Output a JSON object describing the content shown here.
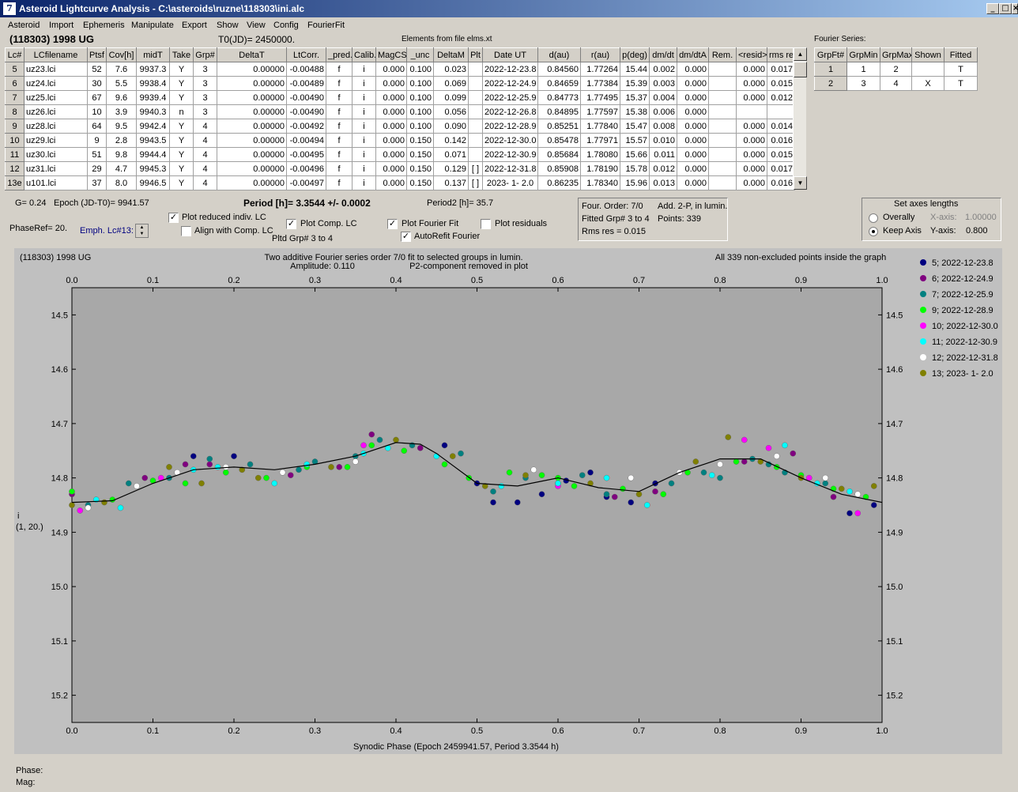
{
  "window": {
    "title": "Asteroid Lightcurve Analysis - C:\\asteroids\\ruzne\\118303\\ini.alc",
    "icon_glyph": "7"
  },
  "menu": [
    "Asteroid",
    "Import",
    "Ephemeris",
    "Manipulate",
    "Export",
    "Show",
    "View",
    "Config",
    "FourierFit"
  ],
  "header": {
    "object": "(118303) 1998 UG",
    "t0": "T0(JD)= 2450000.",
    "elements": "Elements from file elms.xt",
    "fourier_title": "Fourier Series:"
  },
  "lc_table": {
    "columns": [
      "Lc#",
      "LCfilename",
      "Ptsf",
      "Cov[h]",
      "midT",
      "Take",
      "Grp#",
      "DeltaT",
      "LtCorr.",
      "_pred.",
      "Calib.",
      "MagCS",
      "_unc",
      "DeltaM",
      "Plt",
      "Date UT",
      "d(au)",
      "r(au)",
      "p(deg)",
      "dm/dt",
      "dm/dtA",
      "Rem.",
      "<resid>",
      "rms res"
    ],
    "rows": [
      [
        "5",
        "uz23.lci",
        "52",
        "7.6",
        "9937.3",
        "Y",
        "3",
        "0.00000",
        "-0.00488",
        "f",
        "i",
        "0.000",
        "0.100",
        "0.023",
        "",
        "2022-12-23.8",
        "0.84560",
        "1.77264",
        "15.44",
        "0.002",
        "0.000",
        "",
        "0.000",
        "0.017"
      ],
      [
        "6",
        "uz24.lci",
        "30",
        "5.5",
        "9938.4",
        "Y",
        "3",
        "0.00000",
        "-0.00489",
        "f",
        "i",
        "0.000",
        "0.100",
        "0.069",
        "",
        "2022-12-24.9",
        "0.84659",
        "1.77384",
        "15.39",
        "0.003",
        "0.000",
        "",
        "0.000",
        "0.015"
      ],
      [
        "7",
        "uz25.lci",
        "67",
        "9.6",
        "9939.4",
        "Y",
        "3",
        "0.00000",
        "-0.00490",
        "f",
        "i",
        "0.000",
        "0.100",
        "0.099",
        "",
        "2022-12-25.9",
        "0.84773",
        "1.77495",
        "15.37",
        "0.004",
        "0.000",
        "",
        "0.000",
        "0.012"
      ],
      [
        "8",
        "uz26.lci",
        "10",
        "3.9",
        "9940.3",
        "n",
        "3",
        "0.00000",
        "-0.00490",
        "f",
        "i",
        "0.000",
        "0.100",
        "0.056",
        "",
        "2022-12-26.8",
        "0.84895",
        "1.77597",
        "15.38",
        "0.006",
        "0.000",
        "",
        "",
        ""
      ],
      [
        "9",
        "uz28.lci",
        "64",
        "9.5",
        "9942.4",
        "Y",
        "4",
        "0.00000",
        "-0.00492",
        "f",
        "i",
        "0.000",
        "0.100",
        "0.090",
        "",
        "2022-12-28.9",
        "0.85251",
        "1.77840",
        "15.47",
        "0.008",
        "0.000",
        "",
        "0.000",
        "0.014"
      ],
      [
        "10",
        "uz29.lci",
        "9",
        "2.8",
        "9943.5",
        "Y",
        "4",
        "0.00000",
        "-0.00494",
        "f",
        "i",
        "0.000",
        "0.150",
        "0.142",
        "",
        "2022-12-30.0",
        "0.85478",
        "1.77971",
        "15.57",
        "0.010",
        "0.000",
        "",
        "0.000",
        "0.016"
      ],
      [
        "11",
        "uz30.lci",
        "51",
        "9.8",
        "9944.4",
        "Y",
        "4",
        "0.00000",
        "-0.00495",
        "f",
        "i",
        "0.000",
        "0.150",
        "0.071",
        "",
        "2022-12-30.9",
        "0.85684",
        "1.78080",
        "15.66",
        "0.011",
        "0.000",
        "",
        "0.000",
        "0.015"
      ],
      [
        "12",
        "uz31.lci",
        "29",
        "4.7",
        "9945.3",
        "Y",
        "4",
        "0.00000",
        "-0.00496",
        "f",
        "i",
        "0.000",
        "0.150",
        "0.129",
        "[ ]",
        "2022-12-31.8",
        "0.85908",
        "1.78190",
        "15.78",
        "0.012",
        "0.000",
        "",
        "0.000",
        "0.017"
      ],
      [
        "13e",
        "u101.lci",
        "37",
        "8.0",
        "9946.5",
        "Y",
        "4",
        "0.00000",
        "-0.00497",
        "f",
        "i",
        "0.000",
        "0.150",
        "0.137",
        "[ ]",
        "2023- 1- 2.0",
        "0.86235",
        "1.78340",
        "15.96",
        "0.013",
        "0.000",
        "",
        "0.000",
        "0.016"
      ]
    ]
  },
  "fourier_table": {
    "columns": [
      "GrpFt#",
      "GrpMin",
      "GrpMax",
      "Shown",
      "Fitted"
    ],
    "rows": [
      [
        "1",
        "1",
        "2",
        "",
        "T"
      ],
      [
        "2",
        "3",
        "4",
        "X",
        "T"
      ]
    ]
  },
  "info": {
    "g": "G= 0.24",
    "epoch": "Epoch (JD-T0)= 9941.57",
    "period": "Period [h]= 3.3544 +/- 0.0002",
    "period2": "Period2 [h]= 35.7",
    "phaseref": "PhaseRef= 20.",
    "emph": "Emph. Lc#13:",
    "four_order": "Four. Order:  7/0",
    "add2p": "Add. 2-P, in lumin.",
    "fitted_grp": "Fitted Grp# 3 to 4",
    "points": "Points: 339",
    "rms": "Rms res      = 0.015",
    "pltd_grp": "Pltd Grp#  3  to  4"
  },
  "checkboxes": {
    "plot_reduced": {
      "label": "Plot reduced indiv. LC",
      "checked": "✓"
    },
    "align_comp": {
      "label": "Align with Comp. LC",
      "checked": ""
    },
    "plot_comp": {
      "label": "Plot Comp. LC",
      "checked": "✓"
    },
    "plot_fourier": {
      "label": "Plot Fourier Fit",
      "checked": "✓"
    },
    "autorefit": {
      "label": "AutoRefit Fourier",
      "checked": "✓"
    },
    "plot_residuals": {
      "label": "Plot residuals",
      "checked": ""
    }
  },
  "axes_group": {
    "title": "Set axes lengths",
    "overally": "Overally",
    "keep_axis": "Keep Axis",
    "xaxis_label": "X-axis:",
    "xaxis_value": "1.00000",
    "yaxis_label": "Y-axis:",
    "yaxis_value": "0.800"
  },
  "footer": {
    "phase": "Phase:",
    "mag": "Mag:"
  },
  "chart_data": {
    "type": "scatter",
    "top_left": "(118303) 1998 UG",
    "title": "Two additive Fourier series order 7/0 fit to selected groups in lumin.",
    "subtitle_amp": "Amplitude: 0.110",
    "subtitle_p2": "P2-component removed in plot",
    "top_right": "All 339 non-excluded points inside the graph",
    "xlabel": "Synodic Phase (Epoch 2459941.57, Period 3.3544 h)",
    "ylabel": "i",
    "ylabel2": "(1, 20.)",
    "xlim": [
      0.0,
      1.0
    ],
    "ylim": [
      15.25,
      14.45
    ],
    "y_inverted": true,
    "x_ticks": [
      "0.0",
      "0.1",
      "0.2",
      "0.3",
      "0.4",
      "0.5",
      "0.6",
      "0.7",
      "0.8",
      "0.9",
      "1.0"
    ],
    "y_ticks": [
      "14.5",
      "14.6",
      "14.7",
      "14.8",
      "14.9",
      "15.0",
      "15.1",
      "15.2"
    ],
    "fit_curve": {
      "x": [
        0.0,
        0.05,
        0.1,
        0.15,
        0.2,
        0.25,
        0.3,
        0.35,
        0.4,
        0.43,
        0.45,
        0.5,
        0.55,
        0.6,
        0.65,
        0.7,
        0.75,
        0.8,
        0.85,
        0.9,
        0.95,
        1.0
      ],
      "y": [
        14.845,
        14.842,
        14.81,
        14.785,
        14.78,
        14.785,
        14.775,
        14.76,
        14.735,
        14.738,
        14.755,
        14.81,
        14.815,
        14.8,
        14.818,
        14.825,
        14.79,
        14.765,
        14.765,
        14.8,
        14.83,
        14.845
      ]
    },
    "series": [
      {
        "name": "5; 2022-12-23.8",
        "color": "#000080",
        "x": [
          0.15,
          0.2,
          0.46,
          0.5,
          0.52,
          0.55,
          0.58,
          0.6,
          0.61,
          0.64,
          0.66,
          0.69,
          0.72,
          0.96,
          0.99
        ],
        "y": [
          14.76,
          14.76,
          14.74,
          14.81,
          14.845,
          14.845,
          14.83,
          14.81,
          14.805,
          14.79,
          14.835,
          14.845,
          14.81,
          14.865,
          14.85
        ]
      },
      {
        "name": "6; 2022-12-24.9",
        "color": "#800080",
        "x": [
          0.0,
          0.09,
          0.14,
          0.17,
          0.27,
          0.33,
          0.37,
          0.43,
          0.67,
          0.72,
          0.83,
          0.89,
          0.94
        ],
        "y": [
          14.83,
          14.8,
          14.775,
          14.775,
          14.795,
          14.78,
          14.72,
          14.745,
          14.835,
          14.825,
          14.77,
          14.755,
          14.835
        ]
      },
      {
        "name": "7; 2022-12-25.9",
        "color": "#008080",
        "x": [
          0.02,
          0.07,
          0.12,
          0.17,
          0.22,
          0.28,
          0.3,
          0.35,
          0.38,
          0.42,
          0.48,
          0.52,
          0.56,
          0.63,
          0.66,
          0.74,
          0.78,
          0.8,
          0.84,
          0.86,
          0.88,
          0.93
        ],
        "y": [
          14.85,
          14.81,
          14.8,
          14.765,
          14.775,
          14.785,
          14.77,
          14.76,
          14.73,
          14.74,
          14.755,
          14.825,
          14.8,
          14.795,
          14.83,
          14.81,
          14.79,
          14.8,
          14.765,
          14.775,
          14.79,
          14.81
        ]
      },
      {
        "name": "9; 2022-12-28.9",
        "color": "#00ff00",
        "x": [
          0.0,
          0.05,
          0.1,
          0.14,
          0.19,
          0.24,
          0.29,
          0.34,
          0.37,
          0.41,
          0.46,
          0.49,
          0.54,
          0.58,
          0.6,
          0.62,
          0.68,
          0.73,
          0.76,
          0.82,
          0.87,
          0.9,
          0.94,
          0.98
        ],
        "y": [
          14.825,
          14.84,
          14.805,
          14.81,
          14.79,
          14.8,
          14.78,
          14.78,
          14.74,
          14.75,
          14.775,
          14.8,
          14.79,
          14.795,
          14.8,
          14.815,
          14.82,
          14.83,
          14.79,
          14.77,
          14.78,
          14.795,
          14.82,
          14.835
        ]
      },
      {
        "name": "10; 2022-12-30.0",
        "color": "#ff00ff",
        "x": [
          0.01,
          0.11,
          0.36,
          0.6,
          0.83,
          0.86,
          0.91,
          0.97
        ],
        "y": [
          14.86,
          14.8,
          14.74,
          14.815,
          14.73,
          14.745,
          14.8,
          14.865
        ]
      },
      {
        "name": "11; 2022-12-30.9",
        "color": "#00ffff",
        "x": [
          0.03,
          0.06,
          0.15,
          0.18,
          0.25,
          0.29,
          0.36,
          0.39,
          0.45,
          0.53,
          0.6,
          0.66,
          0.71,
          0.79,
          0.88,
          0.92,
          0.96
        ],
        "y": [
          14.84,
          14.855,
          14.785,
          14.78,
          14.81,
          14.775,
          14.755,
          14.745,
          14.76,
          14.815,
          14.81,
          14.8,
          14.85,
          14.795,
          14.74,
          14.81,
          14.825
        ]
      },
      {
        "name": "12; 2022-12-31.8",
        "color": "#ffffff",
        "x": [
          0.02,
          0.08,
          0.13,
          0.19,
          0.26,
          0.35,
          0.57,
          0.69,
          0.75,
          0.8,
          0.87,
          0.93,
          0.97
        ],
        "y": [
          14.855,
          14.815,
          14.79,
          14.78,
          14.79,
          14.77,
          14.785,
          14.8,
          14.79,
          14.775,
          14.76,
          14.8,
          14.83
        ]
      },
      {
        "name": "13; 2023- 1- 2.0",
        "color": "#808000",
        "x": [
          0.0,
          0.04,
          0.12,
          0.16,
          0.21,
          0.23,
          0.32,
          0.4,
          0.47,
          0.51,
          0.56,
          0.64,
          0.7,
          0.77,
          0.81,
          0.85,
          0.9,
          0.95,
          0.99
        ],
        "y": [
          14.85,
          14.845,
          14.78,
          14.81,
          14.785,
          14.8,
          14.78,
          14.73,
          14.76,
          14.815,
          14.795,
          14.81,
          14.83,
          14.77,
          14.725,
          14.77,
          14.8,
          14.82,
          14.815
        ]
      }
    ]
  }
}
